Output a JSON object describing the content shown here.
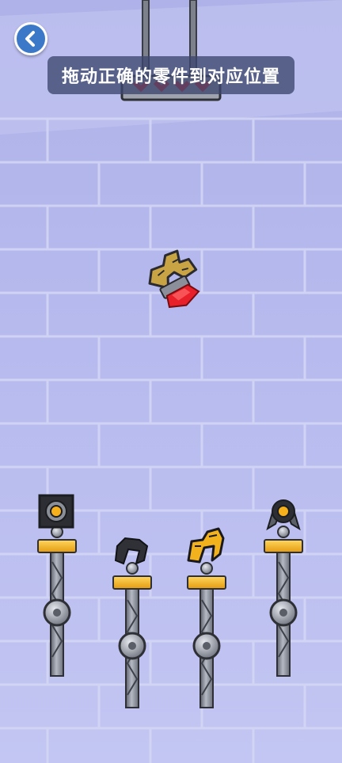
{
  "instruction": {
    "text": "拖动正确的零件到对应位置"
  },
  "back_button": {
    "icon": "chevron-left-icon"
  },
  "colors": {
    "wall": "#b3b7ea",
    "wall_light": "#c8cbf2",
    "brick_line": "#d6d8f6",
    "accent_gold": "#f5b01c",
    "accent_red": "#e8202a",
    "steel": "#8a909c"
  },
  "dragging_part": {
    "name": "claw-hand-with-red-gem"
  },
  "pillars": [
    {
      "name": "pillar-1",
      "part": "box-hub"
    },
    {
      "name": "pillar-2",
      "part": "black-claw"
    },
    {
      "name": "pillar-3",
      "part": "golden-claw"
    },
    {
      "name": "pillar-4",
      "part": "round-hub-claw"
    }
  ]
}
